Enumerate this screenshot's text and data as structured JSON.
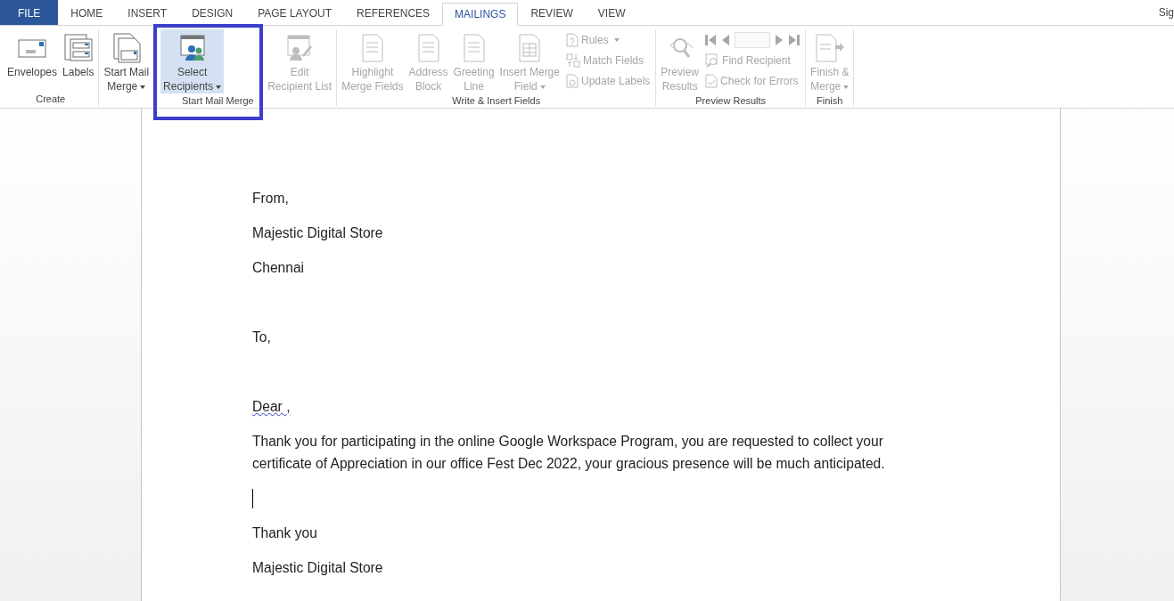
{
  "tabs": [
    {
      "label": "FILE",
      "kind": "file",
      "selected": false
    },
    {
      "label": "HOME",
      "kind": "tab",
      "selected": false
    },
    {
      "label": "INSERT",
      "kind": "tab",
      "selected": false
    },
    {
      "label": "DESIGN",
      "kind": "tab",
      "selected": false
    },
    {
      "label": "PAGE LAYOUT",
      "kind": "tab",
      "selected": false
    },
    {
      "label": "REFERENCES",
      "kind": "tab",
      "selected": false
    },
    {
      "label": "MAILINGS",
      "kind": "tab",
      "selected": true
    },
    {
      "label": "REVIEW",
      "kind": "tab",
      "selected": false
    },
    {
      "label": "VIEW",
      "kind": "tab",
      "selected": false
    }
  ],
  "account": "Sig",
  "groups": [
    {
      "label": "Create",
      "columns": [
        {
          "kind": "large",
          "lines": [
            "Envelopes"
          ],
          "disabled": false,
          "dropdown": false,
          "highlighted": false
        },
        {
          "kind": "large",
          "lines": [
            "Labels"
          ],
          "disabled": false,
          "dropdown": false,
          "highlighted": false
        }
      ]
    },
    {
      "label": "Start Mail Merge",
      "columns": [
        {
          "kind": "large",
          "lines": [
            "Start Mail",
            "Merge"
          ],
          "disabled": false,
          "dropdown": true,
          "highlighted": false
        },
        {
          "kind": "large",
          "lines": [
            "Select",
            "Recipients"
          ],
          "disabled": false,
          "dropdown": true,
          "highlighted": true
        },
        {
          "kind": "large",
          "lines": [
            "Edit",
            "Recipient List"
          ],
          "disabled": true,
          "dropdown": false,
          "highlighted": false
        }
      ]
    },
    {
      "label": "Write & Insert Fields",
      "columns": [
        {
          "kind": "large",
          "lines": [
            "Highlight",
            "Merge Fields"
          ],
          "disabled": true,
          "dropdown": false,
          "highlighted": false
        },
        {
          "kind": "large",
          "lines": [
            "Address",
            "Block"
          ],
          "disabled": true,
          "dropdown": false,
          "highlighted": false
        },
        {
          "kind": "large",
          "lines": [
            "Greeting",
            "Line"
          ],
          "disabled": true,
          "dropdown": false,
          "highlighted": false
        },
        {
          "kind": "large",
          "lines": [
            "Insert Merge",
            "Field"
          ],
          "disabled": true,
          "dropdown": true,
          "highlighted": false
        },
        {
          "kind": "stack",
          "items": [
            {
              "kind": "small",
              "label": "Rules",
              "disabled": true,
              "dropdown": true
            },
            {
              "kind": "small",
              "label": "Match Fields",
              "disabled": true,
              "dropdown": false
            },
            {
              "kind": "small",
              "label": "Update Labels",
              "disabled": true,
              "dropdown": false
            }
          ]
        }
      ]
    },
    {
      "label": "Preview Results",
      "columns": [
        {
          "kind": "large",
          "lines": [
            "Preview",
            "Results"
          ],
          "disabled": true,
          "dropdown": false,
          "highlighted": false
        },
        {
          "kind": "stack",
          "items": [
            {
              "kind": "nav",
              "disabled": true
            },
            {
              "kind": "small",
              "label": "Find Recipient",
              "disabled": true,
              "dropdown": false
            },
            {
              "kind": "small",
              "label": "Check for Errors",
              "disabled": true,
              "dropdown": false
            }
          ]
        }
      ]
    },
    {
      "label": "Finish",
      "columns": [
        {
          "kind": "large",
          "lines": [
            "Finish &",
            "Merge"
          ],
          "disabled": true,
          "dropdown": true,
          "highlighted": false
        }
      ]
    }
  ],
  "document": [
    {
      "kind": "text",
      "text": "From,",
      "misspelled": false
    },
    {
      "kind": "text",
      "text": "Majestic Digital Store",
      "misspelled": false
    },
    {
      "kind": "text",
      "text": "Chennai",
      "misspelled": false
    },
    {
      "kind": "blank"
    },
    {
      "kind": "text",
      "text": "To,",
      "misspelled": false
    },
    {
      "kind": "blank"
    },
    {
      "kind": "text",
      "text": "Dear ,",
      "misspelled": true
    },
    {
      "kind": "text",
      "text": "Thank you for participating in the online Google Workspace Program, you are requested to collect your certificate of Appreciation in our office Fest Dec 2022, your gracious presence will be much anticipated.",
      "misspelled": false
    },
    {
      "kind": "cursor"
    },
    {
      "kind": "text",
      "text": "Thank you",
      "misspelled": false
    },
    {
      "kind": "text",
      "text": "Majestic Digital Store",
      "misspelled": false
    }
  ]
}
